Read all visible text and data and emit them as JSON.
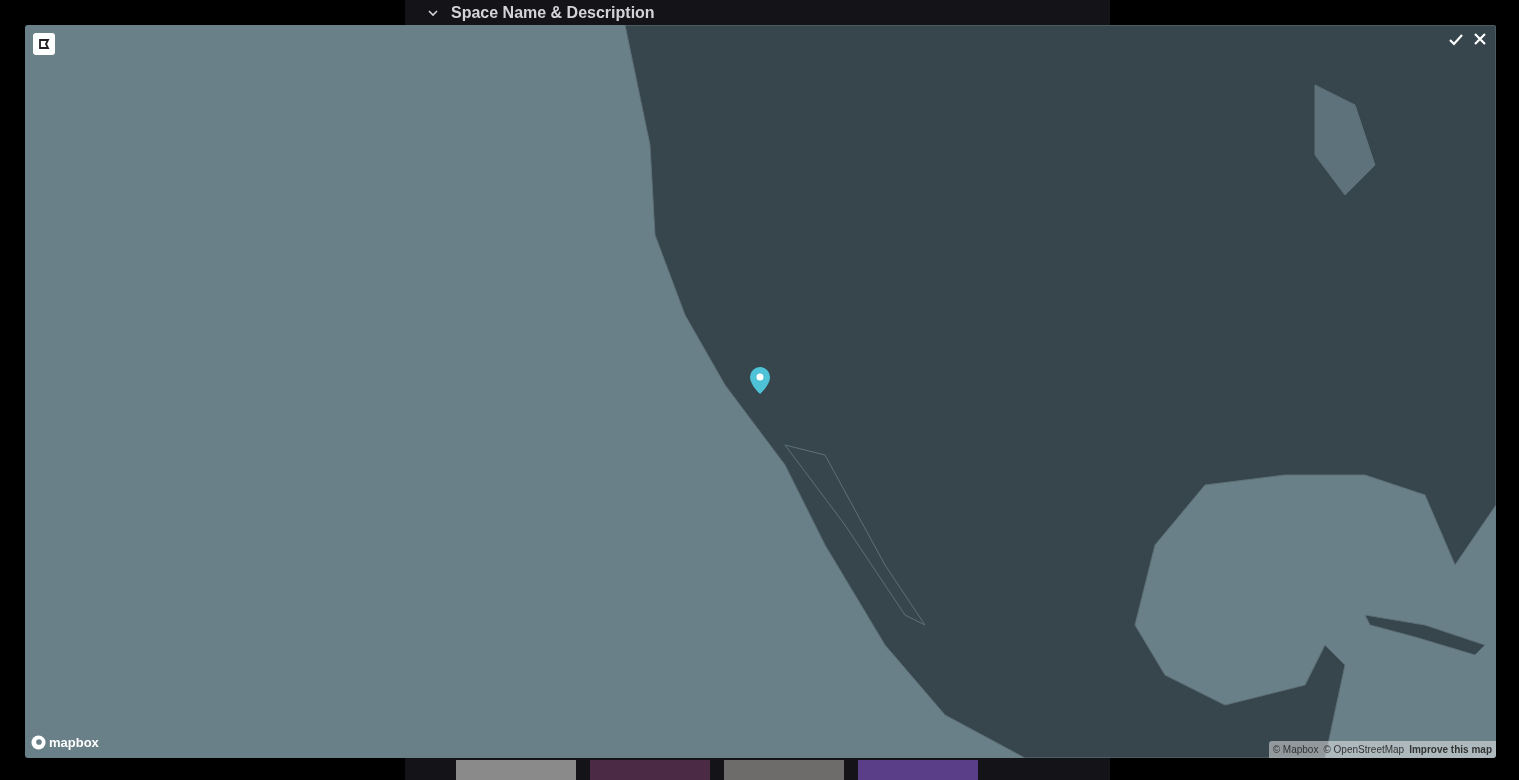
{
  "section": {
    "title": "Space Name & Description",
    "expanded": true
  },
  "map": {
    "logo": "mapbox",
    "attribution": [
      "© Mapbox",
      "© OpenStreetMap",
      "Improve this map"
    ]
  }
}
